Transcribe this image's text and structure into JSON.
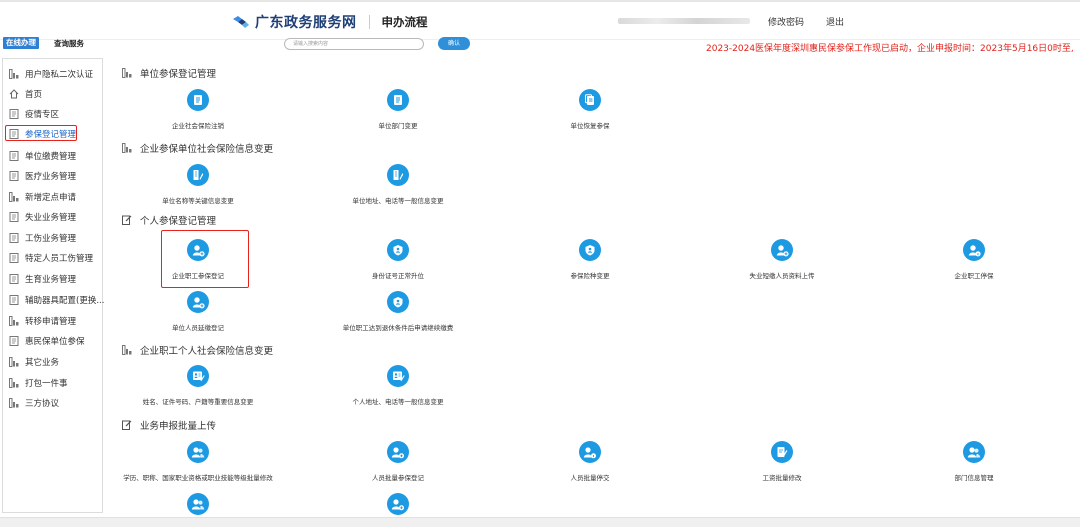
{
  "header": {
    "site_name": "广东政务服务网",
    "process_link": "申办流程",
    "change_password": "修改密码",
    "logout": "退出"
  },
  "topbar": {
    "tab_online": "在线办理",
    "tab_query": "查询服务",
    "search_placeholder": "请输入搜索内容",
    "search_button": "确认",
    "notice": "2023-2024医保年度深圳惠民保参保工作现已启动，企业申报时间：2023年5月16日0时至,"
  },
  "sidebar": {
    "items": [
      {
        "label": "用户隐私二次认证",
        "icon": "grid-icon"
      },
      {
        "label": "首页",
        "icon": "home-icon"
      },
      {
        "label": "疫情专区",
        "icon": "doc-icon"
      },
      {
        "label": "参保登记管理",
        "icon": "doc-icon"
      },
      {
        "label": "单位缴费管理",
        "icon": "doc-icon"
      },
      {
        "label": "医疗业务管理",
        "icon": "doc-icon"
      },
      {
        "label": "新增定点申请",
        "icon": "grid-icon"
      },
      {
        "label": "失业业务管理",
        "icon": "doc-icon"
      },
      {
        "label": "工伤业务管理",
        "icon": "doc-icon"
      },
      {
        "label": "特定人员工伤管理",
        "icon": "doc-icon"
      },
      {
        "label": "生育业务管理",
        "icon": "doc-icon"
      },
      {
        "label": "辅助器具配置(更换...",
        "icon": "doc-icon"
      },
      {
        "label": "转移申请管理",
        "icon": "grid-icon"
      },
      {
        "label": "惠民保单位参保",
        "icon": "doc-icon"
      },
      {
        "label": "其它业务",
        "icon": "grid-icon"
      },
      {
        "label": "打包一件事",
        "icon": "grid-icon"
      },
      {
        "label": "三方协议",
        "icon": "grid-icon"
      }
    ],
    "active_index": 3
  },
  "sections": [
    {
      "title": "单位参保登记管理",
      "icon": "grid-icon",
      "tiles": [
        {
          "label": "企业社会保险注销",
          "icon": "document-icon"
        },
        {
          "label": "单位部门变更",
          "icon": "document-icon"
        },
        {
          "label": "单位恢复参保",
          "icon": "copy-icon"
        }
      ]
    },
    {
      "title": "企业参保单位社会保险信息变更",
      "icon": "grid-icon",
      "tiles": [
        {
          "label": "单位名称等关键信息变更",
          "icon": "building-edit-icon"
        },
        {
          "label": "单位地址、电话等一般信息变更",
          "icon": "building-edit-icon"
        }
      ]
    },
    {
      "title": "个人参保登记管理",
      "icon": "edit-icon",
      "tiles": [
        {
          "label": "企业职工参保登记",
          "icon": "user-add-icon"
        },
        {
          "label": "身份证号正常升位",
          "icon": "shield-icon"
        },
        {
          "label": "参保险种变更",
          "icon": "shield-icon"
        },
        {
          "label": "失业短缴人员资料上传",
          "icon": "user-add-icon"
        },
        {
          "label": "企业职工停保",
          "icon": "user-info-icon"
        },
        {
          "label": "单位人员延缴登记",
          "icon": "user-add-icon"
        },
        {
          "label": "单位职工达到退休条件后申请继续缴费",
          "icon": "shield-icon"
        }
      ]
    },
    {
      "title": "企业职工个人社会保险信息变更",
      "icon": "grid-icon",
      "tiles": [
        {
          "label": "姓名、证件号码、户籍等重要信息变更",
          "icon": "id-edit-icon"
        },
        {
          "label": "个人地址、电话等一般信息变更",
          "icon": "id-edit-icon"
        }
      ]
    },
    {
      "title": "业务申报批量上传",
      "icon": "edit-icon",
      "tiles": [
        {
          "label": "学历、职称、国家职业资格或职业技能等级批量修改",
          "icon": "users-icon"
        },
        {
          "label": "人员批量参保登记",
          "icon": "users-add-icon"
        },
        {
          "label": "人员批量停交",
          "icon": "users-info-icon"
        },
        {
          "label": "工资批量修改",
          "icon": "doc-edit-icon"
        },
        {
          "label": "部门信息管理",
          "icon": "users-icon"
        },
        {
          "label": "",
          "icon": "users-icon"
        },
        {
          "label": "",
          "icon": "users-add-icon"
        }
      ]
    }
  ],
  "colors": {
    "accent": "#1e9ae3",
    "highlight": "#e8231b",
    "notice": "#e0221b"
  }
}
